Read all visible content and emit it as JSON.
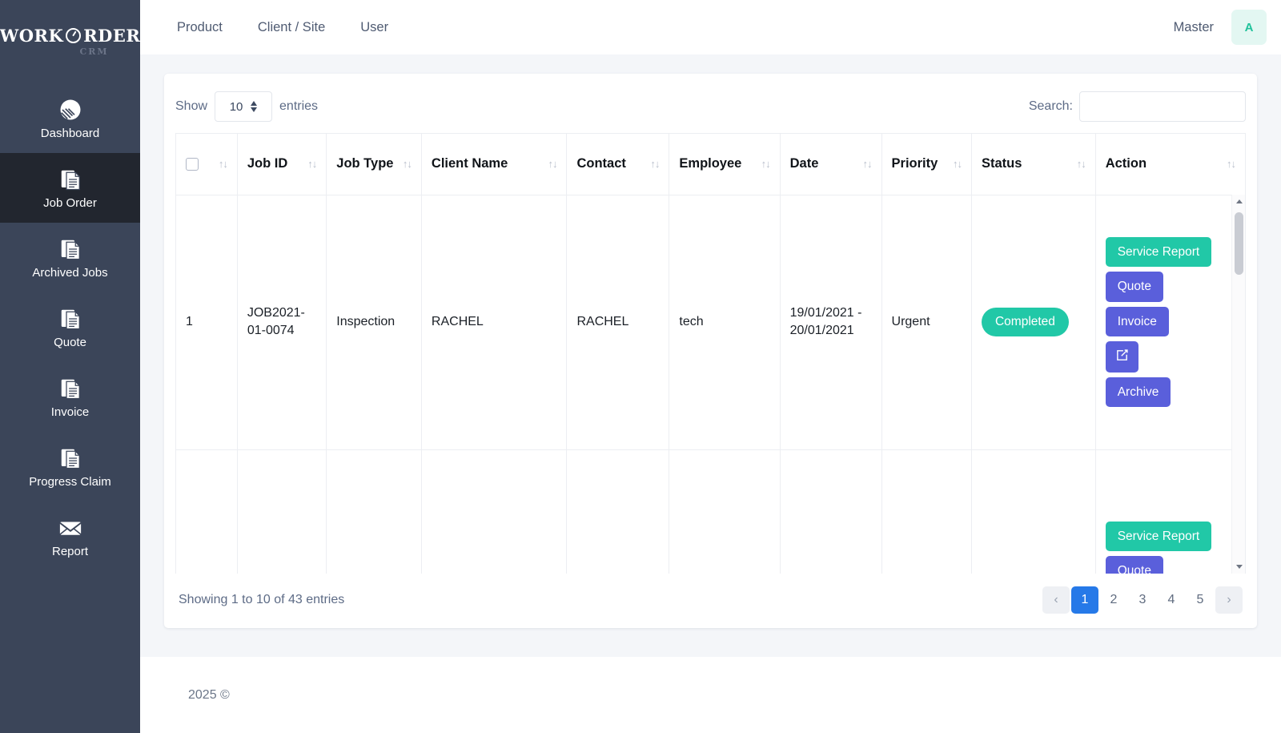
{
  "brand": {
    "word1": "WORK",
    "word2": "RDER",
    "sub": "CRM",
    "clock_icon": "clock-icon"
  },
  "sidebar": {
    "items": [
      {
        "label": "Dashboard",
        "icon": "pie-chart-icon",
        "active": false
      },
      {
        "label": "Job Order",
        "icon": "documents-icon",
        "active": true
      },
      {
        "label": "Archived Jobs",
        "icon": "documents-icon",
        "active": false
      },
      {
        "label": "Quote",
        "icon": "documents-icon",
        "active": false
      },
      {
        "label": "Invoice",
        "icon": "documents-icon",
        "active": false
      },
      {
        "label": "Progress Claim",
        "icon": "documents-icon",
        "active": false
      },
      {
        "label": "Report",
        "icon": "envelope-icon",
        "active": false
      }
    ]
  },
  "topbar": {
    "links": [
      {
        "label": "Product"
      },
      {
        "label": "Client / Site"
      },
      {
        "label": "User"
      }
    ],
    "master_label": "Master",
    "avatar_initial": "A"
  },
  "table_controls": {
    "show_label": "Show",
    "entries_label": "entries",
    "page_length": "10",
    "search_label": "Search:",
    "search_value": "",
    "search_placeholder": ""
  },
  "table": {
    "columns": [
      {
        "label": "",
        "name": "select-all",
        "sortable": true
      },
      {
        "label": "Job ID",
        "name": "job-id",
        "sortable": true
      },
      {
        "label": "Job Type",
        "name": "job-type",
        "sortable": true
      },
      {
        "label": "Client Name",
        "name": "client-name",
        "sortable": true
      },
      {
        "label": "Contact",
        "name": "contact",
        "sortable": true
      },
      {
        "label": "Employee",
        "name": "employee",
        "sortable": true
      },
      {
        "label": "Date",
        "name": "date",
        "sortable": true
      },
      {
        "label": "Priority",
        "name": "priority",
        "sortable": true
      },
      {
        "label": "Status",
        "name": "status",
        "sortable": true
      },
      {
        "label": "Action",
        "name": "action",
        "sortable": true
      }
    ],
    "rows": [
      {
        "index": "1",
        "job_id": "JOB2021-01-0074",
        "job_type": "Inspection",
        "client_name": "RACHEL",
        "contact": "RACHEL",
        "employee": "tech",
        "date": "19/01/2021 - 20/01/2021",
        "priority": "Urgent",
        "status": "Completed",
        "actions": [
          "Service Report",
          "Quote",
          "Invoice",
          "edit-icon",
          "Archive"
        ]
      },
      {
        "index": "",
        "job_id": "",
        "job_type": "",
        "client_name": "",
        "contact": "",
        "employee": "",
        "date": "",
        "priority": "",
        "status": "",
        "actions": [
          "Service Report",
          "Quote"
        ]
      }
    ],
    "action_labels": {
      "service_report": "Service Report",
      "quote": "Quote",
      "invoice": "Invoice",
      "edit": "edit-icon",
      "archive": "Archive"
    }
  },
  "table_footer": {
    "info": "Showing 1 to 10 of 43 entries",
    "pagination": {
      "prev": "‹",
      "next": "›",
      "pages": [
        "1",
        "2",
        "3",
        "4",
        "5"
      ],
      "active_page": "1"
    }
  },
  "page_footer": {
    "copyright": "2025 ©"
  },
  "colors": {
    "sidebar_bg": "#3b4559",
    "sidebar_active": "#22262f",
    "accent_teal": "#21c8a7",
    "accent_purple": "#5a5fdb",
    "pagination_active": "#2679e8",
    "avatar_bg": "#e3f7f2",
    "avatar_fg": "#21c29b"
  }
}
